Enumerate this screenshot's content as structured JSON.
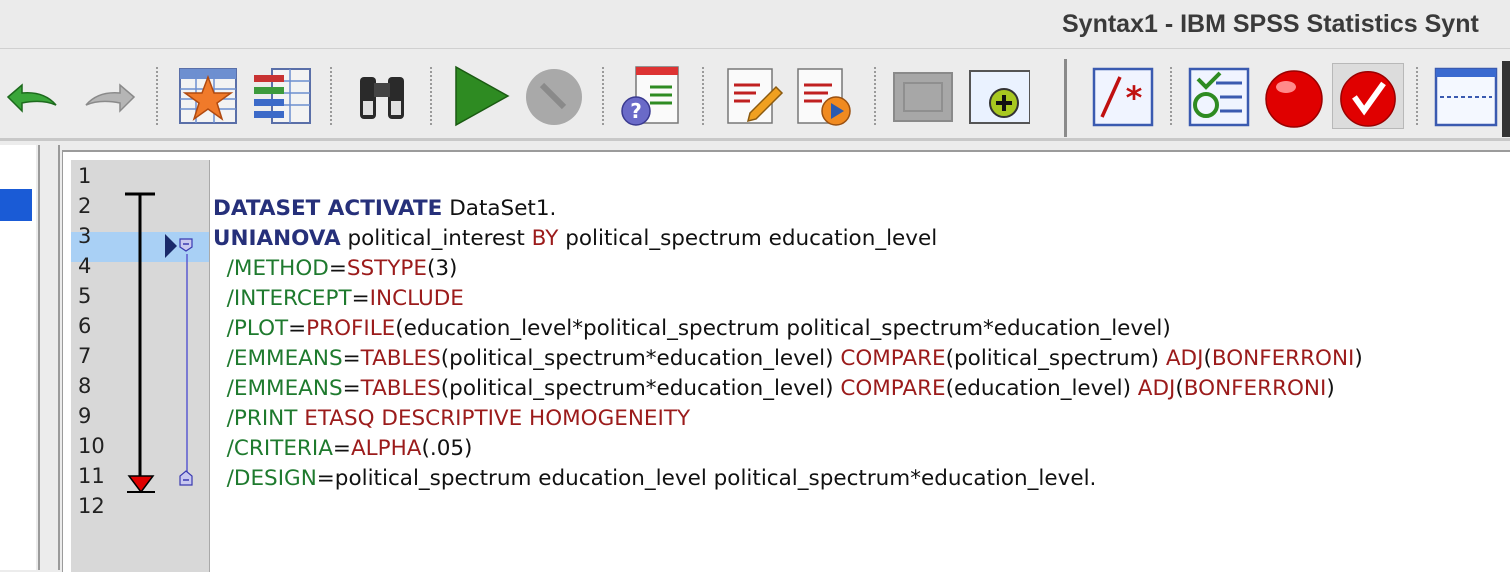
{
  "window": {
    "title": "Syntax1 - IBM SPSS Statistics Synt"
  },
  "toolbar": {
    "icons": [
      "undo-icon",
      "redo-icon",
      "goto-data-icon",
      "variables-icon",
      "find-icon",
      "run-icon",
      "stop-icon",
      "syntax-help-icon",
      "edit-icon",
      "run-to-end-icon",
      "breakpoint-area-icon",
      "add-icon",
      "comment-icon",
      "verify-icon",
      "breakpoint-icon",
      "clear-breakpoints-icon",
      "split-window-icon"
    ],
    "colors": {
      "run": "#2e8b22",
      "breakpoint": "#e00000",
      "accent": "#1a5bd6"
    }
  },
  "editor": {
    "line_numbers": [
      "1",
      "2",
      "3",
      "4",
      "5",
      "6",
      "7",
      "8",
      "9",
      "10",
      "11",
      "12"
    ],
    "current_line": "3",
    "lines": [
      [],
      [
        {
          "t": "kw",
          "v": "DATASET ACTIVATE"
        },
        {
          "t": "tx",
          "v": " DataSet1."
        }
      ],
      [
        {
          "t": "kw",
          "v": "UNIANOVA"
        },
        {
          "t": "tx",
          "v": " political_interest "
        },
        {
          "t": "fn",
          "v": "BY"
        },
        {
          "t": "tx",
          "v": " political_spectrum education_level"
        }
      ],
      [
        {
          "t": "tx",
          "v": "  "
        },
        {
          "t": "sub",
          "v": "/METHOD"
        },
        {
          "t": "tx",
          "v": "="
        },
        {
          "t": "fn",
          "v": "SSTYPE"
        },
        {
          "t": "tx",
          "v": "(3)"
        }
      ],
      [
        {
          "t": "tx",
          "v": "  "
        },
        {
          "t": "sub",
          "v": "/INTERCEPT"
        },
        {
          "t": "tx",
          "v": "="
        },
        {
          "t": "fn",
          "v": "INCLUDE"
        }
      ],
      [
        {
          "t": "tx",
          "v": "  "
        },
        {
          "t": "sub",
          "v": "/PLOT"
        },
        {
          "t": "tx",
          "v": "="
        },
        {
          "t": "fn",
          "v": "PROFILE"
        },
        {
          "t": "tx",
          "v": "(education_level*political_spectrum political_spectrum*education_level)"
        }
      ],
      [
        {
          "t": "tx",
          "v": "  "
        },
        {
          "t": "sub",
          "v": "/EMMEANS"
        },
        {
          "t": "tx",
          "v": "="
        },
        {
          "t": "fn",
          "v": "TABLES"
        },
        {
          "t": "tx",
          "v": "(political_spectrum*education_level) "
        },
        {
          "t": "fn",
          "v": "COMPARE"
        },
        {
          "t": "tx",
          "v": "(political_spectrum) "
        },
        {
          "t": "fn",
          "v": "ADJ"
        },
        {
          "t": "tx",
          "v": "("
        },
        {
          "t": "fn",
          "v": "BONFERRONI"
        },
        {
          "t": "tx",
          "v": ")"
        }
      ],
      [
        {
          "t": "tx",
          "v": "  "
        },
        {
          "t": "sub",
          "v": "/EMMEANS"
        },
        {
          "t": "tx",
          "v": "="
        },
        {
          "t": "fn",
          "v": "TABLES"
        },
        {
          "t": "tx",
          "v": "(political_spectrum*education_level) "
        },
        {
          "t": "fn",
          "v": "COMPARE"
        },
        {
          "t": "tx",
          "v": "(education_level) "
        },
        {
          "t": "fn",
          "v": "ADJ"
        },
        {
          "t": "tx",
          "v": "("
        },
        {
          "t": "fn",
          "v": "BONFERRONI"
        },
        {
          "t": "tx",
          "v": ")"
        }
      ],
      [
        {
          "t": "tx",
          "v": "  "
        },
        {
          "t": "sub",
          "v": "/PRINT"
        },
        {
          "t": "tx",
          "v": " "
        },
        {
          "t": "fn",
          "v": "ETASQ DESCRIPTIVE HOMOGENEITY"
        }
      ],
      [
        {
          "t": "tx",
          "v": "  "
        },
        {
          "t": "sub",
          "v": "/CRITERIA"
        },
        {
          "t": "tx",
          "v": "="
        },
        {
          "t": "fn",
          "v": "ALPHA"
        },
        {
          "t": "tx",
          "v": "(.05)"
        }
      ],
      [
        {
          "t": "tx",
          "v": "  "
        },
        {
          "t": "sub",
          "v": "/DESIGN"
        },
        {
          "t": "tx",
          "v": "=political_spectrum education_level political_spectrum*education_level."
        }
      ],
      []
    ]
  }
}
